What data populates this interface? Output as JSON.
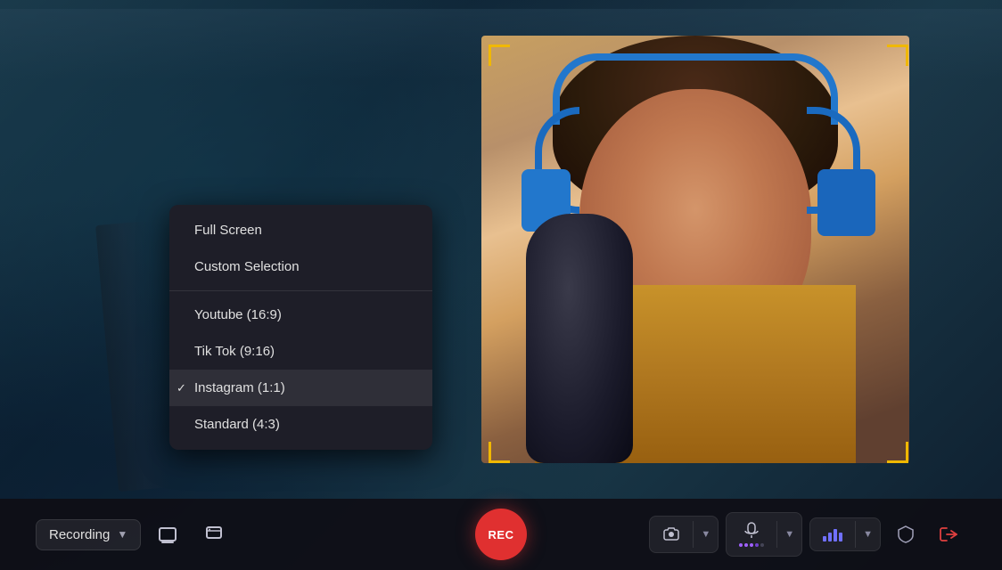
{
  "background": {
    "color": "#1a2a3a"
  },
  "camera": {
    "visible": true,
    "frame_color": "#f0b800"
  },
  "dropdown": {
    "items": [
      {
        "id": "full-screen",
        "label": "Full Screen",
        "checked": false,
        "dividerAfter": false
      },
      {
        "id": "custom-selection",
        "label": "Custom Selection",
        "checked": false,
        "dividerAfter": true
      },
      {
        "id": "youtube",
        "label": "Youtube (16:9)",
        "checked": false,
        "dividerAfter": false
      },
      {
        "id": "tiktok",
        "label": "Tik Tok (9:16)",
        "checked": false,
        "dividerAfter": false
      },
      {
        "id": "instagram",
        "label": "Instagram (1:1)",
        "checked": true,
        "dividerAfter": false
      },
      {
        "id": "standard",
        "label": "Standard (4:3)",
        "checked": false,
        "dividerAfter": false
      }
    ]
  },
  "toolbar": {
    "recording_label": "Recording",
    "rec_button_label": "REC",
    "icons": {
      "screen_capture": "⬜",
      "window_capture": "▭",
      "camera": "📷",
      "mic": "🎙",
      "audio_level": "📊",
      "shield": "🛡",
      "exit": "→"
    }
  }
}
